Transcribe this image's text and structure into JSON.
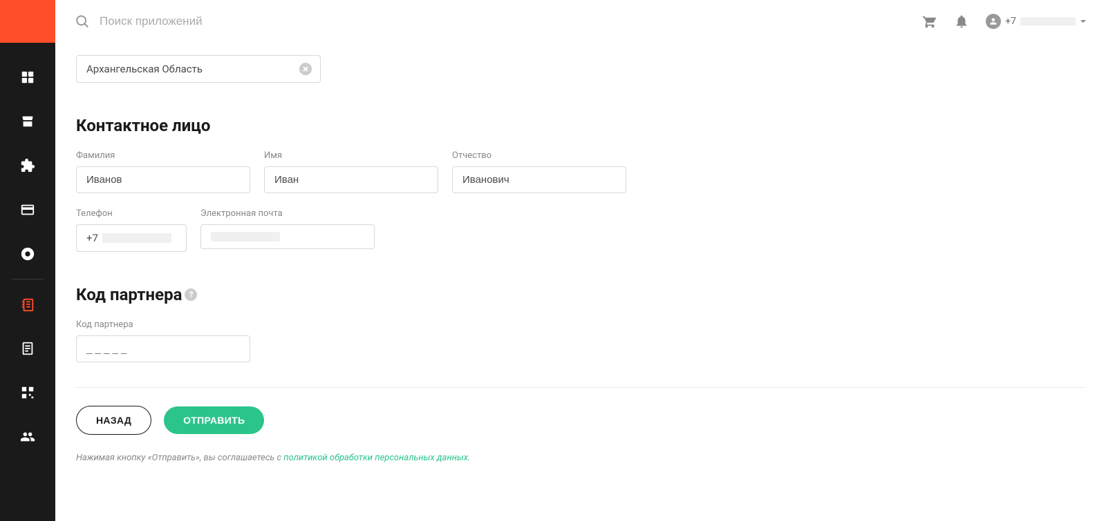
{
  "header": {
    "search_placeholder": "Поиск приложений",
    "user_phone_prefix": "+7"
  },
  "region_chip": {
    "label": "Архангельская Область"
  },
  "contact_section": {
    "title": "Контактное лицо",
    "fields": {
      "lastname": {
        "label": "Фамилия",
        "value": "Иванов"
      },
      "firstname": {
        "label": "Имя",
        "value": "Иван"
      },
      "patronymic": {
        "label": "Отчество",
        "value": "Иванович"
      },
      "phone": {
        "label": "Телефон",
        "prefix": "+7"
      },
      "email": {
        "label": "Электронная почта"
      }
    }
  },
  "partner_section": {
    "title": "Код партнера",
    "code_label": "Код партнера",
    "code_placeholder": "_ _ _ _ _"
  },
  "buttons": {
    "back": "НАЗАД",
    "submit": "ОТПРАВИТЬ"
  },
  "legal": {
    "prefix": "Нажимая кнопку «Отправить», вы соглашаетесь с ",
    "link": "политикой обработки персональных данных",
    "suffix": "."
  }
}
